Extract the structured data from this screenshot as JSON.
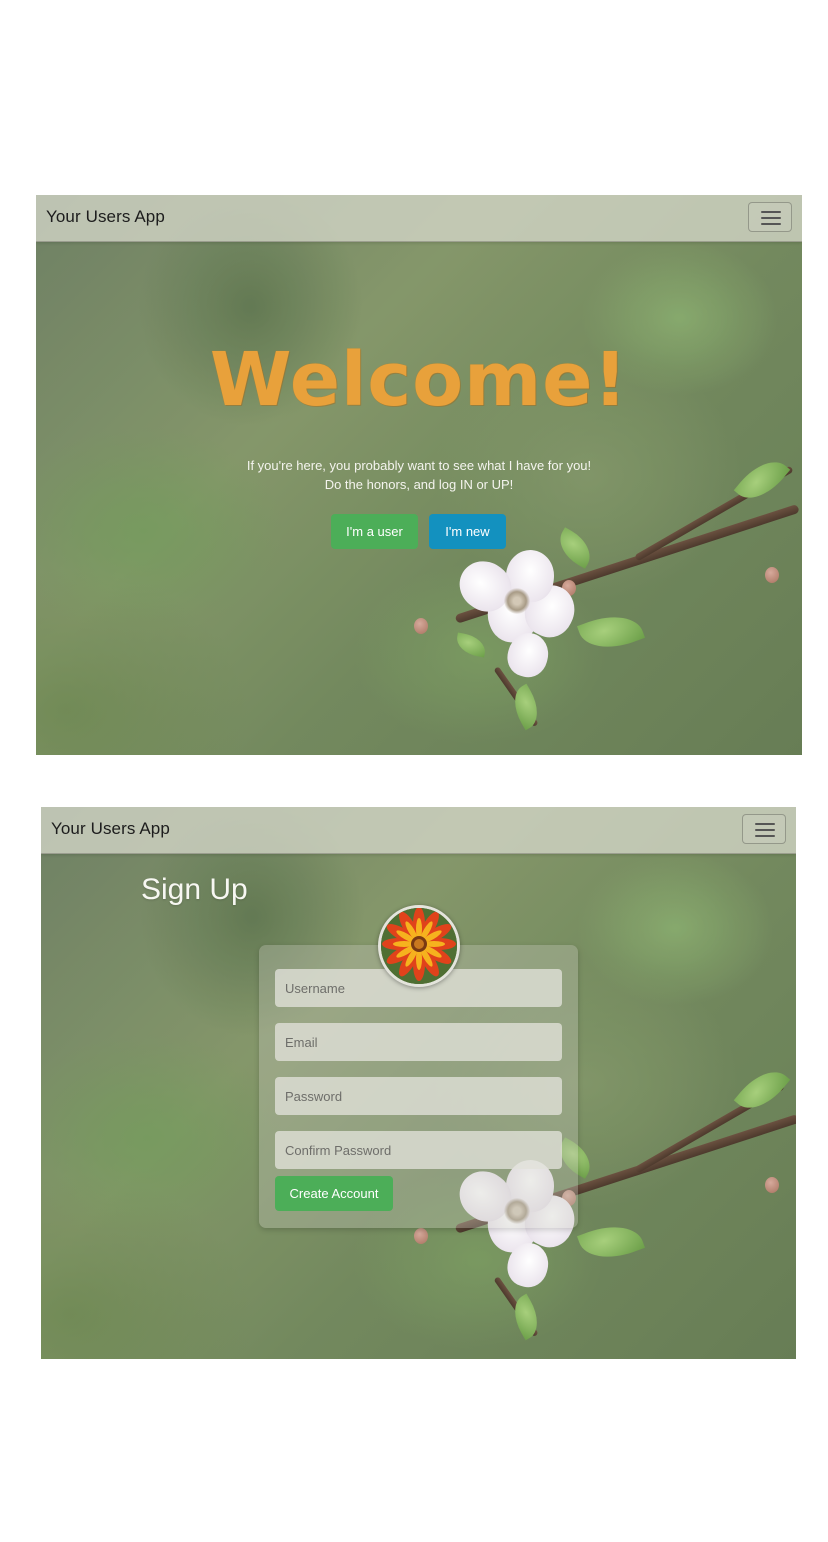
{
  "welcome_screen": {
    "navbar": {
      "brand": "Your Users App",
      "menu_icon": "hamburger-menu-icon"
    },
    "hero": {
      "title": "Welcome!",
      "line1": "If you're here, you probably want to see what I have for you!",
      "line2": "Do the honors, and log IN or UP!",
      "login_button": "I'm a user",
      "signup_button": "I'm new"
    }
  },
  "signup_screen": {
    "navbar": {
      "brand": "Your Users App",
      "menu_icon": "hamburger-menu-icon"
    },
    "title": "Sign Up",
    "avatar_icon": "gazania-flower-avatar",
    "form": {
      "username_placeholder": "Username",
      "email_placeholder": "Email",
      "password_placeholder": "Password",
      "confirm_password_placeholder": "Confirm Password",
      "submit_label": "Create Account"
    }
  },
  "colors": {
    "title_orange": "#e8a13b",
    "button_green": "#4cae58",
    "button_blue": "#1391bf",
    "navbar_bg": "#d4d6c8",
    "background_green": "#7d8f66"
  }
}
